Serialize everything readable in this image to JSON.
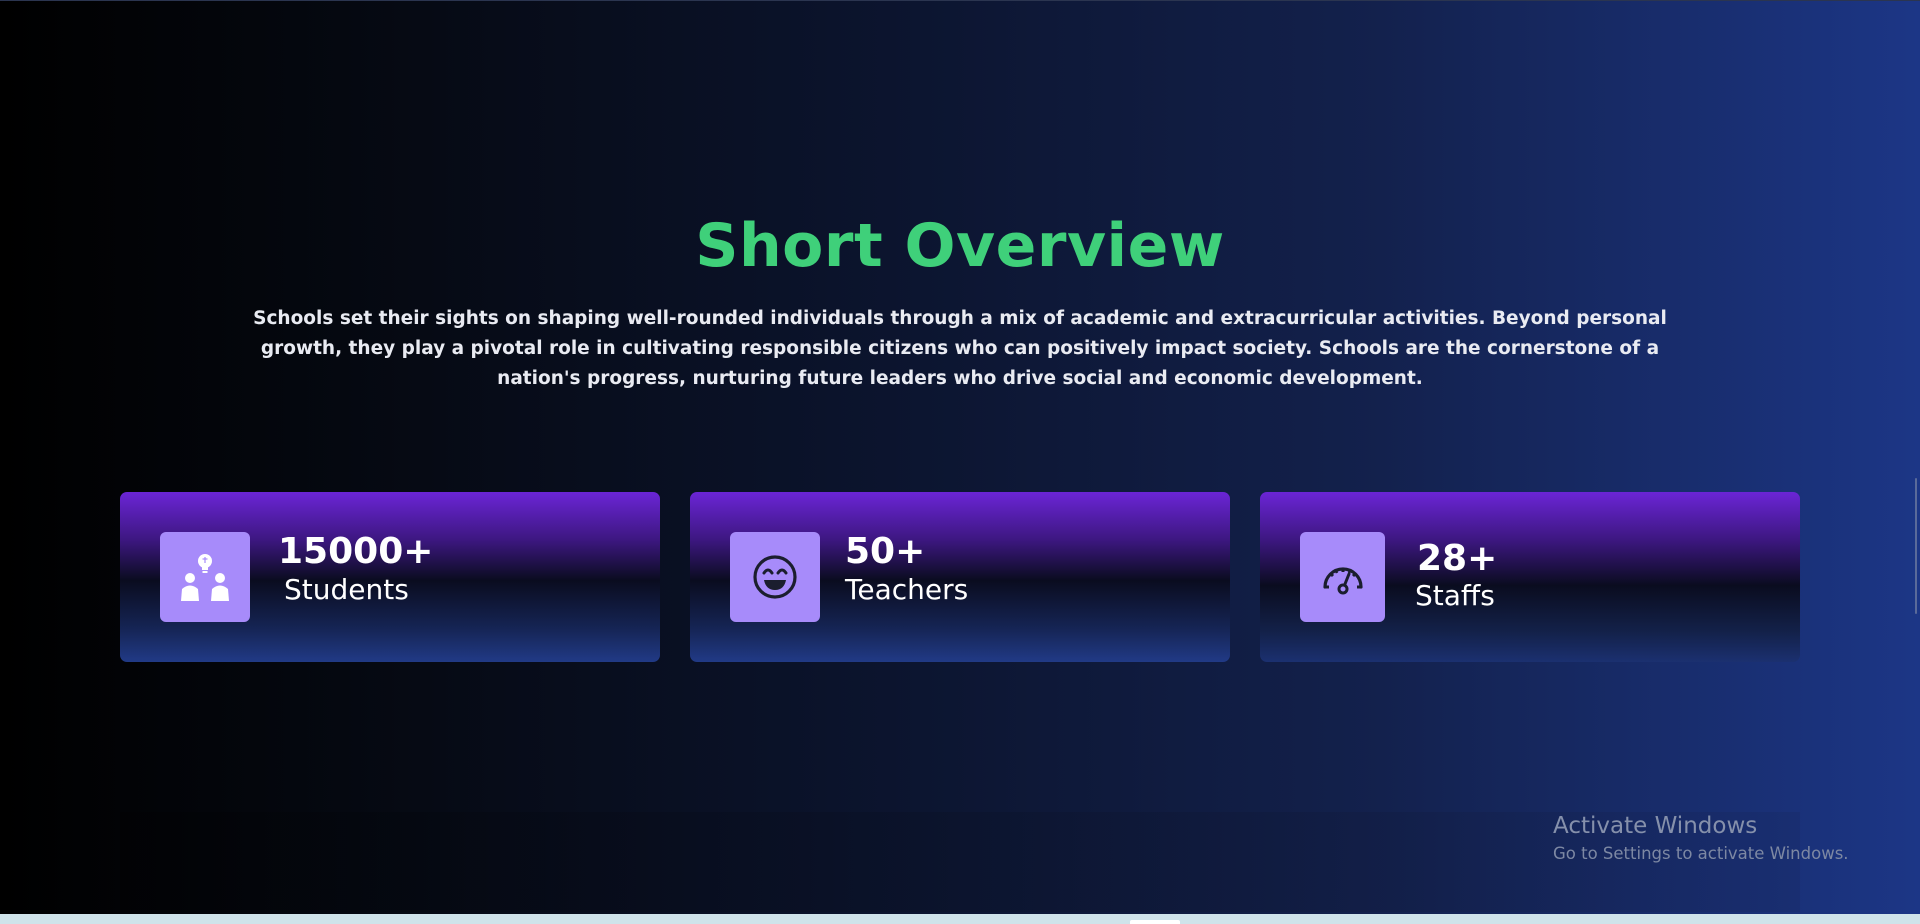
{
  "overview": {
    "title": "Short Overview",
    "description": "Schools set their sights on shaping well-rounded individuals through a mix of academic and extracurricular activities. Beyond personal growth, they play a pivotal role in cultivating responsible citizens who can positively impact society. Schools are the cornerstone of a nation's progress, nurturing future leaders who drive social and economic development."
  },
  "stats": [
    {
      "icon": "students-lightbulb-icon",
      "value": "15000+",
      "label": "Students"
    },
    {
      "icon": "smiley-face-icon",
      "value": "50+",
      "label": "Teachers"
    },
    {
      "icon": "speedometer-icon",
      "value": "28+",
      "label": "Staffs"
    }
  ],
  "windows_watermark": {
    "title": "Activate Windows",
    "subtitle": "Go to Settings to activate Windows."
  },
  "colors": {
    "title_green": "#3fd07a",
    "icon_box_purple": "#a78bfa",
    "card_top_purple": "#6b25d6",
    "background_right_blue": "#1c3686"
  }
}
